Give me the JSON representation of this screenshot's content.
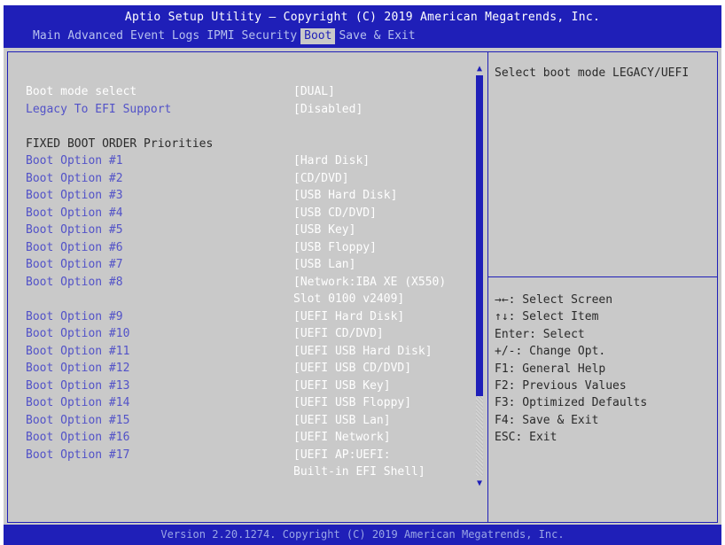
{
  "header": {
    "title": "Aptio Setup Utility – Copyright (C) 2019 American Megatrends, Inc."
  },
  "menu": {
    "tabs": [
      {
        "label": "Main"
      },
      {
        "label": "Advanced"
      },
      {
        "label": "Event Logs"
      },
      {
        "label": "IPMI"
      },
      {
        "label": "Security"
      },
      {
        "label": "Boot",
        "active": true
      },
      {
        "label": "Save & Exit"
      }
    ]
  },
  "settings": {
    "boot_mode": {
      "label": "Boot mode select",
      "value": "[DUAL]"
    },
    "legacy_efi": {
      "label": "Legacy To EFI Support",
      "value": "[Disabled]"
    },
    "section_title": "FIXED BOOT ORDER Priorities",
    "options": [
      {
        "label": "Boot Option #1",
        "value": "[Hard Disk]"
      },
      {
        "label": "Boot Option #2",
        "value": "[CD/DVD]"
      },
      {
        "label": "Boot Option #3",
        "value": "[USB Hard Disk]"
      },
      {
        "label": "Boot Option #4",
        "value": "[USB CD/DVD]"
      },
      {
        "label": "Boot Option #5",
        "value": "[USB Key]"
      },
      {
        "label": "Boot Option #6",
        "value": "[USB Floppy]"
      },
      {
        "label": "Boot Option #7",
        "value": "[USB Lan]"
      },
      {
        "label": "Boot Option #8",
        "value": "[Network:IBA XE (X550)",
        "value_cont": "Slot 0100 v2409]"
      },
      {
        "label": "Boot Option #9",
        "value": "[UEFI Hard Disk]"
      },
      {
        "label": "Boot Option #10",
        "value": "[UEFI CD/DVD]"
      },
      {
        "label": "Boot Option #11",
        "value": "[UEFI USB Hard Disk]"
      },
      {
        "label": "Boot Option #12",
        "value": "[UEFI USB CD/DVD]"
      },
      {
        "label": "Boot Option #13",
        "value": "[UEFI USB Key]"
      },
      {
        "label": "Boot Option #14",
        "value": "[UEFI USB Floppy]"
      },
      {
        "label": "Boot Option #15",
        "value": "[UEFI USB Lan]"
      },
      {
        "label": "Boot Option #16",
        "value": "[UEFI Network]"
      },
      {
        "label": "Boot Option #17",
        "value": "[UEFI AP:UEFI:",
        "value_cont": "Built-in EFI Shell]"
      }
    ]
  },
  "help": {
    "description": "Select boot mode LEGACY/UEFI",
    "keys": [
      "→←: Select Screen",
      "↑↓: Select Item",
      "Enter: Select",
      "+/-: Change Opt.",
      "F1: General Help",
      "F2: Previous Values",
      "F3: Optimized Defaults",
      "F4: Save & Exit",
      "ESC: Exit"
    ]
  },
  "footer": {
    "text": "Version 2.20.1274. Copyright (C) 2019 American Megatrends, Inc."
  },
  "colors": {
    "bar_blue": "#1f1fb8",
    "panel_gray": "#c9c9c9",
    "label_blue": "#5252c8",
    "value_white": "#ffffff"
  }
}
